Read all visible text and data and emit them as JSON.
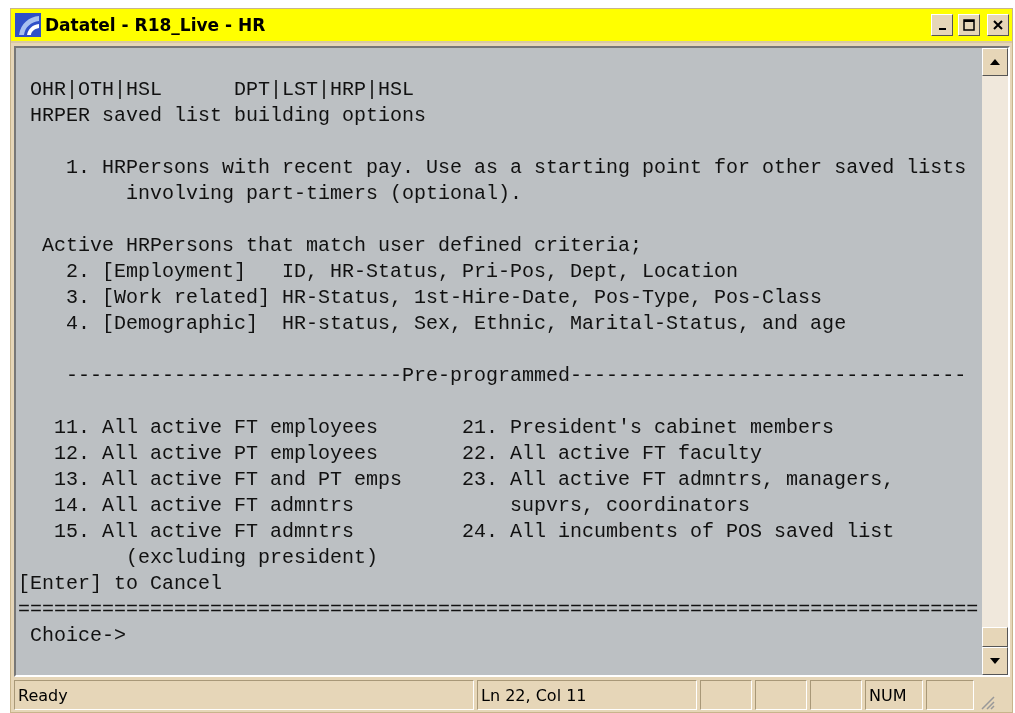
{
  "window": {
    "title": "Datatel - R18_Live - HR"
  },
  "terminal": {
    "path_left": "OHR|OTH|HSL",
    "path_right": "DPT|LST|HRP|HSL",
    "heading": "HRPER saved list building options",
    "intro_option": {
      "text": "1. HRPersons with recent pay. Use as a starting point for other saved lists",
      "continuation": "involving part-timers (optional)."
    },
    "criteria_heading": "Active HRPersons that match user defined criteria;",
    "criteria_options": [
      "2. [Employment]   ID, HR-Status, Pri-Pos, Dept, Location",
      "3. [Work related] HR-Status, 1st-Hire-Date, Pos-Type, Pos-Class",
      "4. [Demographic]  HR-status, Sex, Ethnic, Marital-Status, and age"
    ],
    "section_divider": "----------------------------Pre-programmed---------------------------------",
    "preprogrammed_left": [
      {
        "text": "11. All active FT employees"
      },
      {
        "text": "12. All active PT employees"
      },
      {
        "text": "13. All active FT and PT emps"
      },
      {
        "text": "14. All active FT admntrs"
      },
      {
        "text": "15. All active FT admntrs",
        "continuation": "(excluding president)"
      }
    ],
    "preprogrammed_right": [
      {
        "text": "21. President's cabinet members"
      },
      {
        "text": "22. All active FT faculty"
      },
      {
        "text": "23. All active FT admntrs, managers,",
        "continuation": "supvrs, coordinators"
      },
      {
        "text": "24. All incumbents of POS saved list"
      }
    ],
    "cancel_hint": "[Enter] to Cancel",
    "separator": "================================================================================",
    "prompt": "Choice->"
  },
  "status_bar": {
    "message": "Ready",
    "position": "Ln 22, Col 11",
    "indicator": "NUM"
  }
}
